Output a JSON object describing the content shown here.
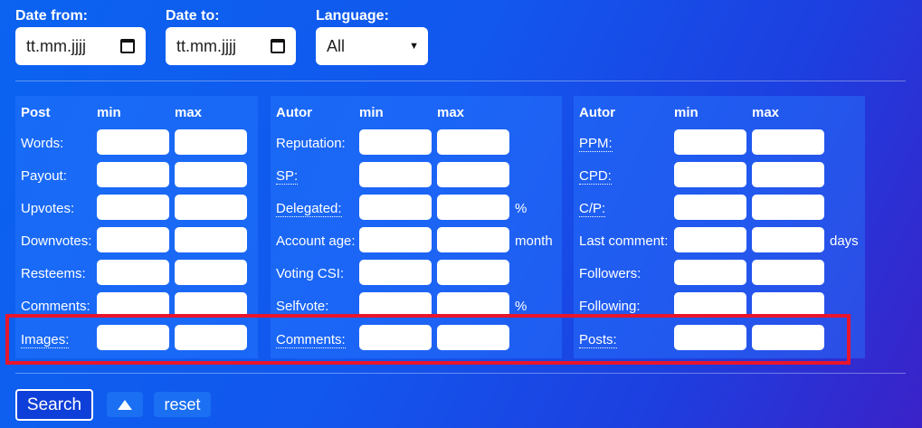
{
  "filters": {
    "date_from": {
      "label": "Date from:",
      "value": "tt.mm.jjjj"
    },
    "date_to": {
      "label": "Date to:",
      "value": "tt.mm.jjjj"
    },
    "language": {
      "label": "Language:",
      "value": "All"
    }
  },
  "panels": [
    {
      "header": "Post",
      "min": "min",
      "max": "max",
      "rows": [
        {
          "label": "Words:",
          "unit": ""
        },
        {
          "label": "Payout:",
          "unit": ""
        },
        {
          "label": "Upvotes:",
          "unit": ""
        },
        {
          "label": "Downvotes:",
          "unit": ""
        },
        {
          "label": "Resteems:",
          "unit": ""
        },
        {
          "label": "Comments:",
          "unit": ""
        },
        {
          "label": "Images:",
          "unit": ""
        }
      ]
    },
    {
      "header": "Autor",
      "min": "min",
      "max": "max",
      "rows": [
        {
          "label": "Reputation:",
          "unit": ""
        },
        {
          "label": "SP:",
          "unit": ""
        },
        {
          "label": "Delegated:",
          "unit": "%"
        },
        {
          "label": "Account age:",
          "unit": "month"
        },
        {
          "label": "Voting CSI:",
          "unit": ""
        },
        {
          "label": "Selfvote:",
          "unit": "%"
        },
        {
          "label": "Comments:",
          "unit": ""
        }
      ]
    },
    {
      "header": "Autor",
      "min": "min",
      "max": "max",
      "rows": [
        {
          "label": "PPM:",
          "unit": ""
        },
        {
          "label": "CPD:",
          "unit": ""
        },
        {
          "label": "C/P:",
          "unit": ""
        },
        {
          "label": "Last comment:",
          "unit": "days"
        },
        {
          "label": "Followers:",
          "unit": ""
        },
        {
          "label": "Following:",
          "unit": ""
        },
        {
          "label": "Posts:",
          "unit": ""
        }
      ]
    }
  ],
  "buttons": {
    "search": "Search",
    "reset": "reset"
  },
  "colors": {
    "highlight": "#e8152c",
    "accent": "#1a6ff2"
  }
}
